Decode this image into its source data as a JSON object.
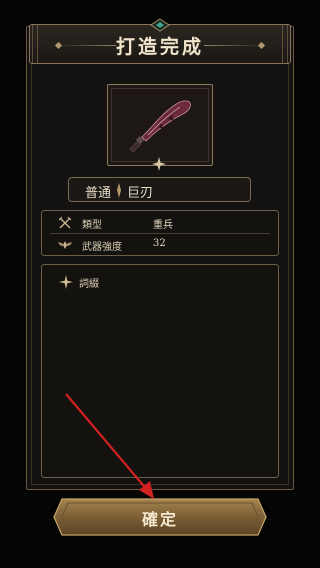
{
  "dialog": {
    "title": "打造完成",
    "item": {
      "rarity": "普通",
      "name": "巨刃",
      "icon": "curved-blade-icon"
    },
    "stats": [
      {
        "label": "類型",
        "value": "重兵",
        "icon": "crossed-swords-icon"
      },
      {
        "label": "武器強度",
        "value": "32",
        "icon": "winged-emblem-icon"
      }
    ],
    "affix": {
      "label": "詞綴",
      "icon": "four-point-star-icon"
    },
    "confirm_label": "確定"
  },
  "annotation": {
    "arrow_color": "#d22121"
  },
  "colors": {
    "accent_gold": "#8d7a5c",
    "background": "#050504",
    "button_gold": "#9a7a4c"
  }
}
